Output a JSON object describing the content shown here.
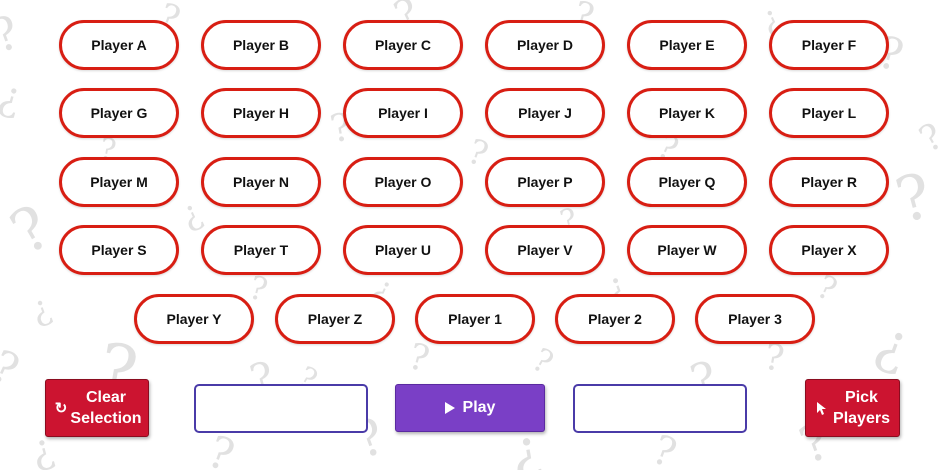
{
  "players": [
    "Player A",
    "Player B",
    "Player C",
    "Player D",
    "Player E",
    "Player F",
    "Player G",
    "Player H",
    "Player I",
    "Player J",
    "Player K",
    "Player L",
    "Player M",
    "Player N",
    "Player O",
    "Player P",
    "Player Q",
    "Player R",
    "Player S",
    "Player T",
    "Player U",
    "Player V",
    "Player W",
    "Player X",
    "Player Y",
    "Player Z",
    "Player 1",
    "Player 2",
    "Player 3"
  ],
  "controls": {
    "clear_selection": {
      "label": "Clear Selection",
      "icon": "refresh-icon"
    },
    "play": {
      "label": "Play",
      "icon": "play-icon"
    },
    "pick_players": {
      "label": "Pick Players",
      "icon": "cursor-icon"
    },
    "left_box_value": "",
    "right_box_value": ""
  },
  "colors": {
    "pill_border": "#d81e13",
    "red_button": "#cc1430",
    "play_button": "#7a3fc6",
    "box_border": "#4a3ba8",
    "background_pattern": "#e1e1e1"
  }
}
